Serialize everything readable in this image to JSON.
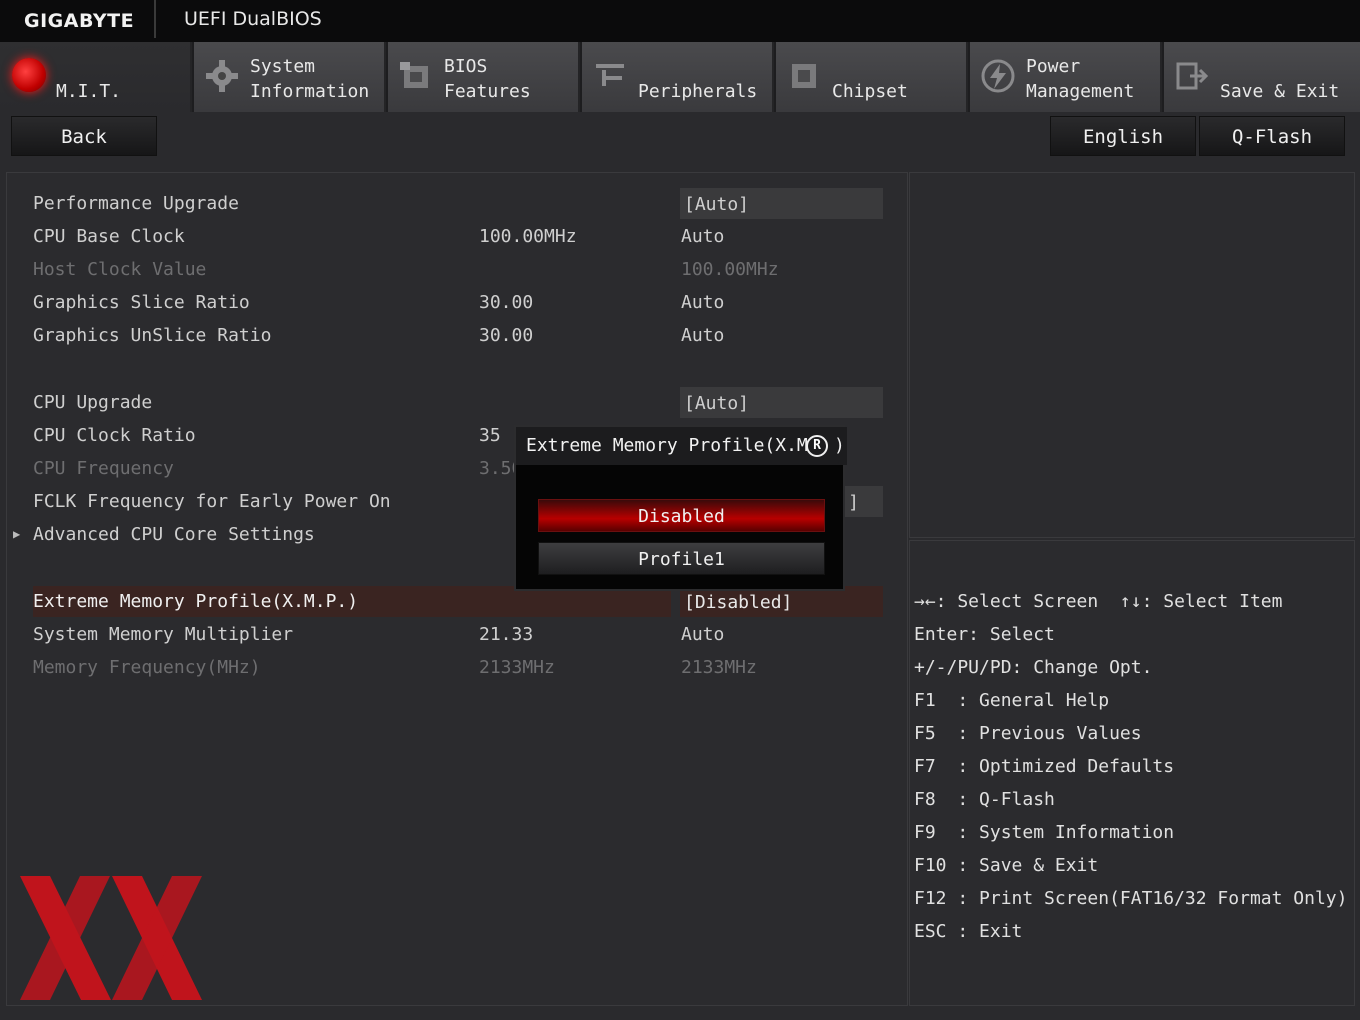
{
  "brand": {
    "name": "GIGABYTE",
    "product": "UEFI DualBIOS"
  },
  "tabs": [
    {
      "label": "M.I.T.",
      "icon": "mit-red-orb-icon",
      "active": true
    },
    {
      "label": "System\nInformation",
      "icon": "gear-icon"
    },
    {
      "label": "BIOS\nFeatures",
      "icon": "bios-chip-icon"
    },
    {
      "label": "Peripherals",
      "icon": "peripherals-icon"
    },
    {
      "label": "Chipset",
      "icon": "chipset-icon"
    },
    {
      "label": "Power\nManagement",
      "icon": "power-bolt-icon"
    },
    {
      "label": "Save & Exit",
      "icon": "exit-door-icon"
    }
  ],
  "toolbar": {
    "back": "Back",
    "language": "English",
    "qflash": "Q-Flash"
  },
  "settings": [
    {
      "label": "Performance Upgrade",
      "current": "",
      "value": "[Auto]"
    },
    {
      "label": "CPU Base Clock",
      "current": "100.00MHz",
      "value": "Auto"
    },
    {
      "label": "Host Clock Value",
      "current": "",
      "value": "100.00MHz"
    },
    {
      "label": "Graphics Slice Ratio",
      "current": "30.00",
      "value": "Auto"
    },
    {
      "label": "Graphics UnSlice Ratio",
      "current": "30.00",
      "value": "Auto"
    },
    {
      "label": "CPU Upgrade",
      "current": "",
      "value": "[Auto]"
    },
    {
      "label": "CPU Clock Ratio",
      "current": "35",
      "value": ""
    },
    {
      "label": "CPU Frequency",
      "current": "3.50",
      "value": ""
    },
    {
      "label": "FCLK Frequency for Early Power On",
      "current": "",
      "value": "]"
    },
    {
      "label": "Advanced CPU Core Settings",
      "current": "",
      "value": ""
    },
    {
      "label": "Extreme Memory Profile(X.M.P.)",
      "current": "",
      "value": "[Disabled]"
    },
    {
      "label": "System Memory Multiplier",
      "current": "21.33",
      "value": "Auto"
    },
    {
      "label": "Memory Frequency(MHz)",
      "current": "2133MHz",
      "value": "2133MHz"
    }
  ],
  "popup": {
    "title": "Extreme Memory Profile(X.M",
    "title_end": ")",
    "reg_mark": "R",
    "options": [
      "Disabled",
      "Profile1"
    ]
  },
  "help": [
    "→←: Select Screen  ↑↓: Select Item",
    "Enter: Select",
    "+/-/PU/PD: Change Opt.",
    "F1  : General Help",
    "F5  : Previous Values",
    "F7  : Optimized Defaults",
    "F8  : Q-Flash",
    "F9  : System Information",
    "F10 : Save & Exit",
    "F12 : Print Screen(FAT16/32 Format Only)",
    "ESC : Exit"
  ],
  "colors": {
    "accent": "#c00000",
    "selected_row": "#3a2421",
    "logo_red": "#c0141c"
  }
}
